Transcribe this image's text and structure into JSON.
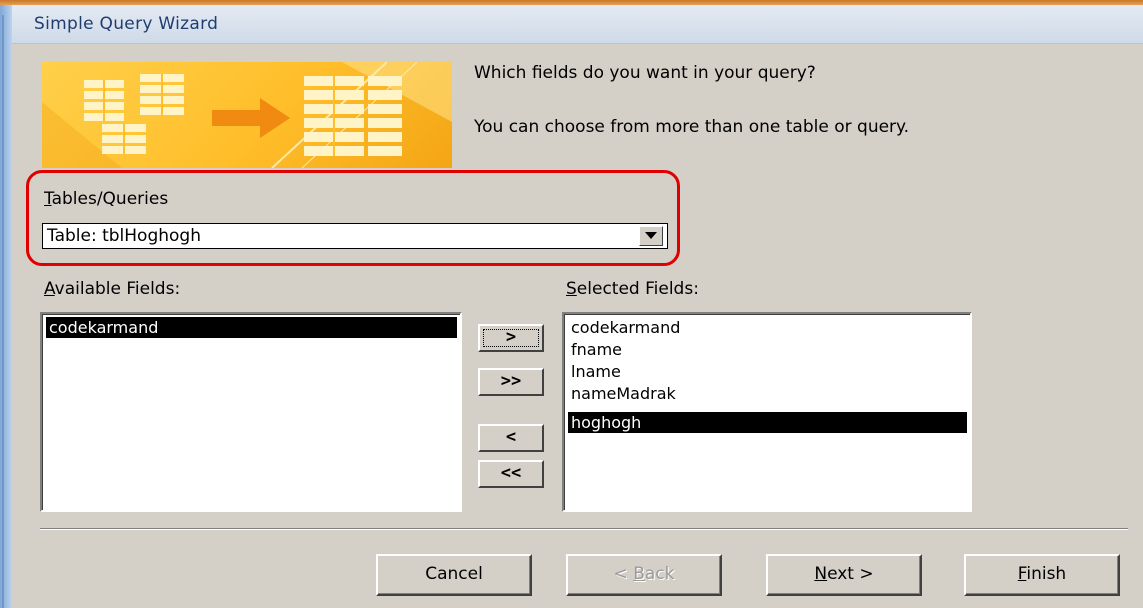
{
  "window": {
    "title": "Simple Query Wizard"
  },
  "prompt": {
    "line1": "Which fields do you want in your query?",
    "line2": "You can choose from more than one table or query."
  },
  "tables_queries": {
    "label_first": "T",
    "label_rest": "ables/Queries",
    "selected": "Table: tblHoghogh"
  },
  "available": {
    "label_first": "A",
    "label_rest": "vailable Fields:",
    "items": [
      "codekarmand"
    ]
  },
  "selected_fields": {
    "label_first": "S",
    "label_rest": "elected Fields:",
    "items": [
      "codekarmand",
      "fname",
      "lname",
      "nameMadrak",
      "hoghogh"
    ]
  },
  "move_buttons": {
    "add_one": ">",
    "add_all": ">>",
    "remove_one": "<",
    "remove_all": "<<"
  },
  "buttons": {
    "cancel": "Cancel",
    "back_prefix": "< ",
    "back_key": "B",
    "back_rest": "ack",
    "next_key": "N",
    "next_rest": "ext >",
    "finish_key": "F",
    "finish_rest": "inish"
  },
  "colors": {
    "highlight_outline": "#e00000",
    "banner": "#ffbe2a",
    "selection": "#000000"
  }
}
